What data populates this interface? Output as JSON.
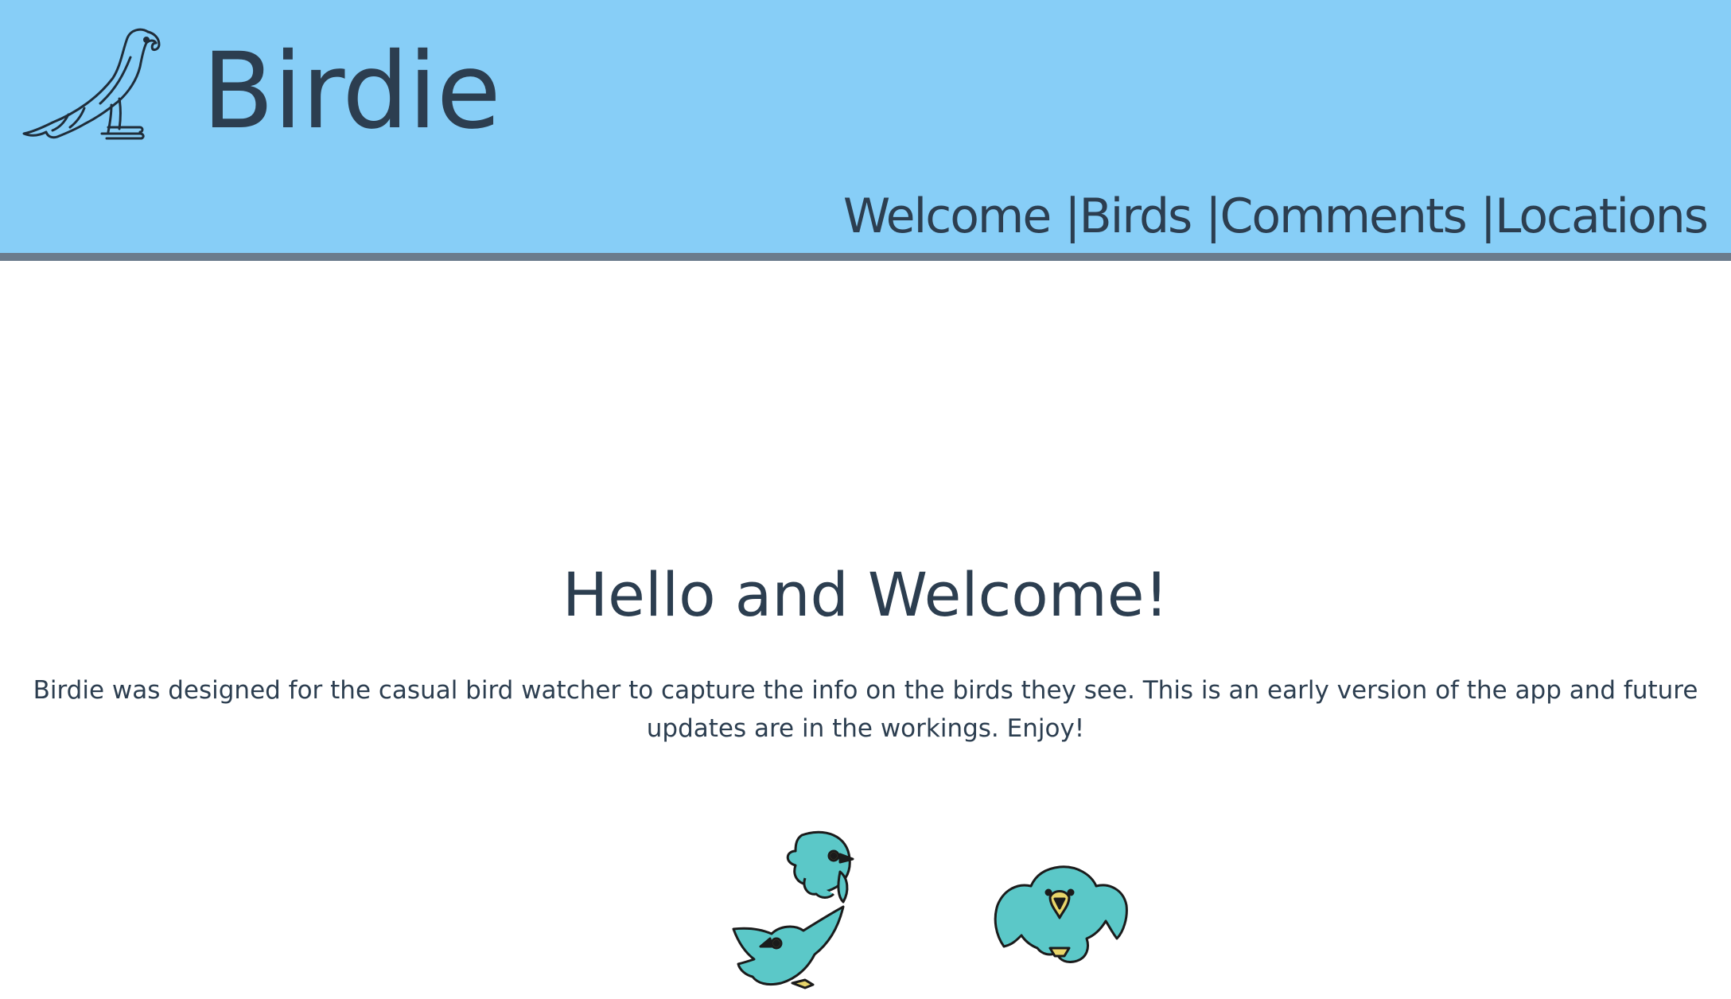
{
  "header": {
    "brand": "Birdie",
    "logo_icon": "bird-outline-icon",
    "background": "#87cef7",
    "border_color": "#6b7c8c"
  },
  "nav": {
    "items": [
      {
        "label": "Welcome"
      },
      {
        "label": "Birds"
      },
      {
        "label": "Comments"
      },
      {
        "label": "Locations"
      }
    ],
    "separator": "|"
  },
  "main": {
    "title": "Hello and Welcome!",
    "intro": "Birdie was designed for the casual bird watcher to capture the info on the birds they see. This is an early version of the app and future updates are in the workings. Enjoy!",
    "illustrations": [
      "two-blue-birds-icon",
      "flying-blue-bird-icon"
    ],
    "bird_color": "#5bc8c8"
  }
}
